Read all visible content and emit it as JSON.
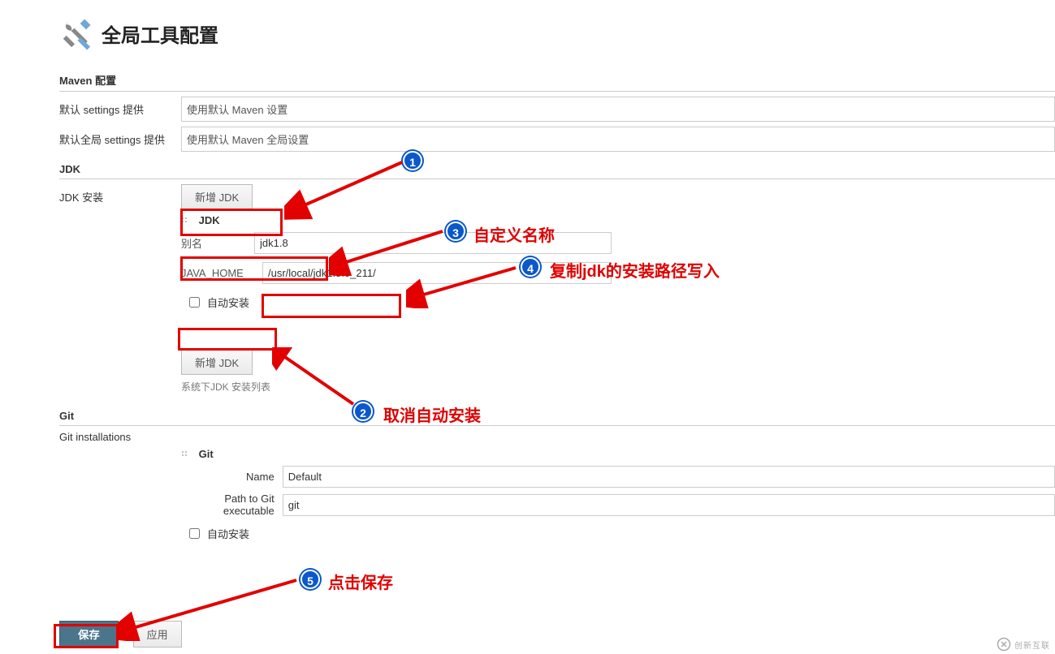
{
  "page_title": "全局工具配置",
  "sections": {
    "maven": {
      "header": "Maven 配置",
      "default_settings_label": "默认 settings 提供",
      "default_settings_value": "使用默认 Maven 设置",
      "global_settings_label": "默认全局 settings 提供",
      "global_settings_value": "使用默认 Maven 全局设置"
    },
    "jdk": {
      "header": "JDK",
      "install_label": "JDK 安装",
      "add_btn_1": "新增 JDK",
      "entry_title": "JDK",
      "alias_label": "别名",
      "alias_value": "jdk1.8",
      "java_home_label": "JAVA_HOME",
      "java_home_value": "/usr/local/jdk1.8.0_211/",
      "auto_install_label": "自动安装",
      "add_btn_2": "新增 JDK",
      "list_hint": "系统下JDK 安装列表"
    },
    "git": {
      "header": "Git",
      "install_label": "Git installations",
      "entry_title": "Git",
      "name_label": "Name",
      "name_value": "Default",
      "path_label": "Path to Git executable",
      "path_value": "git",
      "auto_install_label": "自动安装"
    }
  },
  "buttons": {
    "save": "保存",
    "apply": "应用"
  },
  "annotations": {
    "a1_text": "",
    "a2_text": "取消自动安装",
    "a3_text": "自定义名称",
    "a4_text": "复制jdk的安装路径写入",
    "a5_text": "点击保存"
  },
  "watermark": "创新互联"
}
